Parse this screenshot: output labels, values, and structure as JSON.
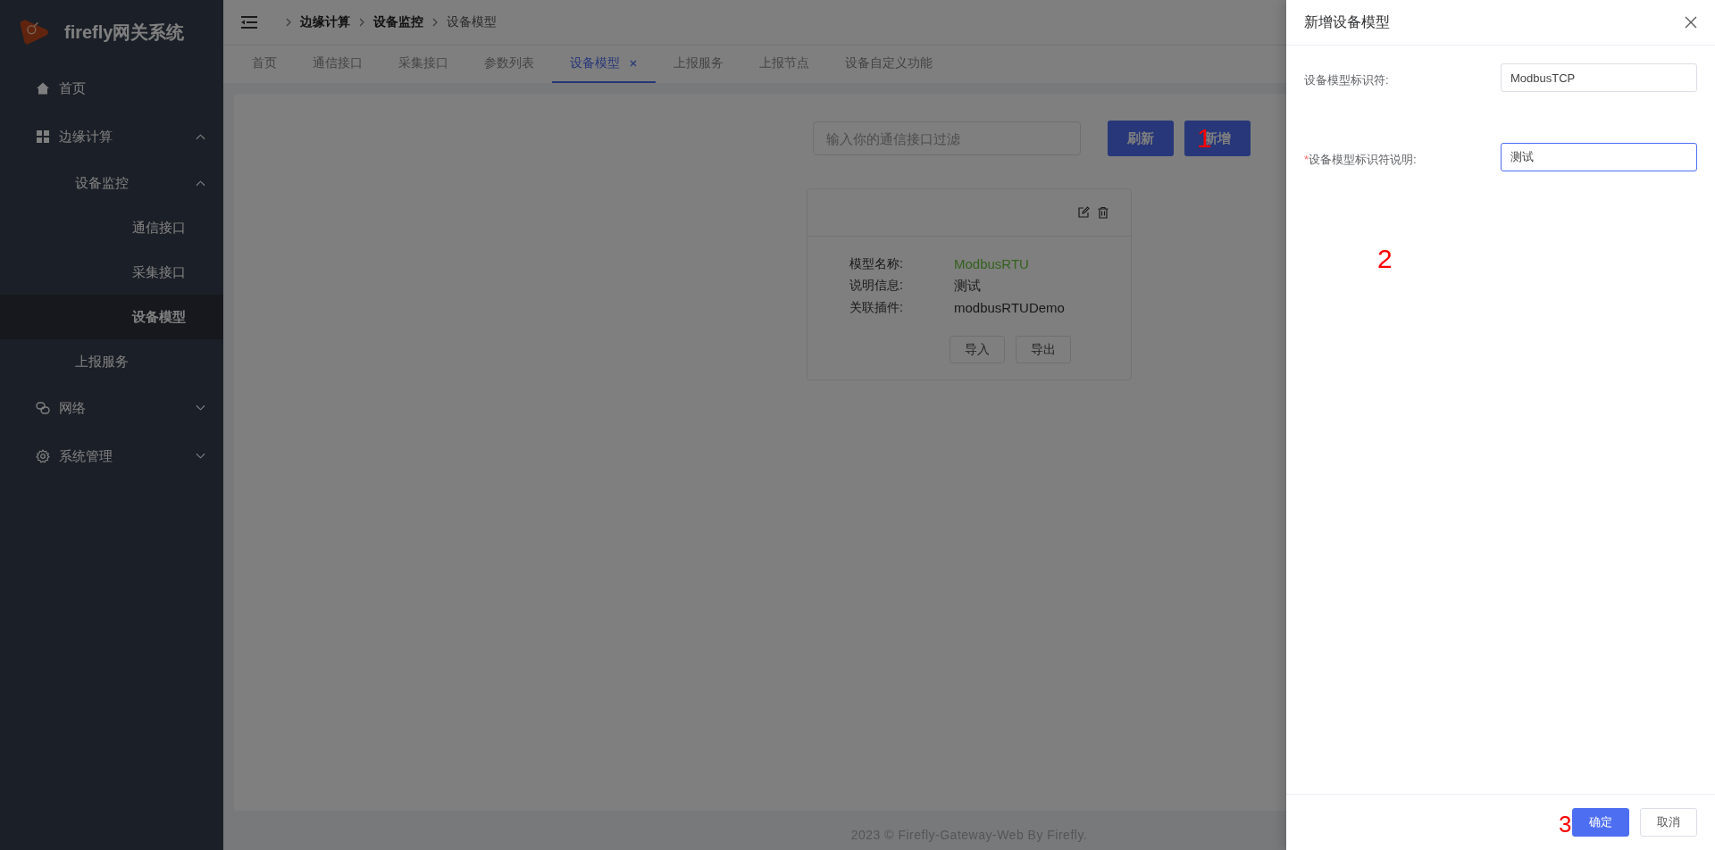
{
  "sidebar": {
    "logo_text": "firefly网关系统",
    "items": [
      {
        "label": "首页",
        "selected": false
      },
      {
        "label": "边缘计算",
        "expanded": true,
        "selected": false,
        "children": [
          {
            "label": "设备监控",
            "expanded": true,
            "selected": false,
            "children": [
              {
                "label": "通信接口",
                "selected": false
              },
              {
                "label": "采集接口",
                "selected": false
              },
              {
                "label": "设备模型",
                "selected": true
              }
            ]
          },
          {
            "label": "上报服务",
            "selected": false
          }
        ]
      },
      {
        "label": "网络",
        "expanded": false,
        "selected": false
      },
      {
        "label": "系统管理",
        "expanded": false,
        "selected": false
      }
    ]
  },
  "breadcrumb": [
    "边缘计算",
    "设备监控",
    "设备模型"
  ],
  "tabs": [
    {
      "label": "首页",
      "selected": false
    },
    {
      "label": "通信接口",
      "selected": false
    },
    {
      "label": "采集接口",
      "selected": false
    },
    {
      "label": "参数列表",
      "selected": false
    },
    {
      "label": "设备模型",
      "selected": true
    },
    {
      "label": "上报服务",
      "selected": false
    },
    {
      "label": "上报节点",
      "selected": false
    },
    {
      "label": "设备自定义功能",
      "selected": false
    }
  ],
  "toolbar": {
    "filter_placeholder": "输入你的通信接口过滤",
    "buttons": [
      {
        "label": "刷新"
      },
      {
        "label": "新增",
        "annotation": "1"
      }
    ]
  },
  "card": {
    "fields": [
      {
        "label": "模型名称:",
        "value": "ModbusRTU",
        "color": "#34611d"
      },
      {
        "label": "说明信息:",
        "value": "测试",
        "color": "#181818"
      },
      {
        "label": "关联插件:",
        "value": "modbusRTUDemo",
        "color": "#181818"
      }
    ],
    "buttons": [
      "导入",
      "导出"
    ]
  },
  "footer": "2023 © Firefly-Gateway-Web By Firefly.",
  "drawer": {
    "title": "新增设备模型",
    "annotation": "2",
    "fields": [
      {
        "label": "设备模型标识符:",
        "value": "ModbusTCP",
        "focused": false
      },
      {
        "label": "设备模型标识符说明:",
        "value": "测试",
        "required_mark": "*",
        "focused": true
      }
    ],
    "buttons": [
      {
        "label": "确定",
        "kind": "primary",
        "annotation": "3"
      },
      {
        "label": "取消",
        "kind": "default"
      }
    ]
  }
}
